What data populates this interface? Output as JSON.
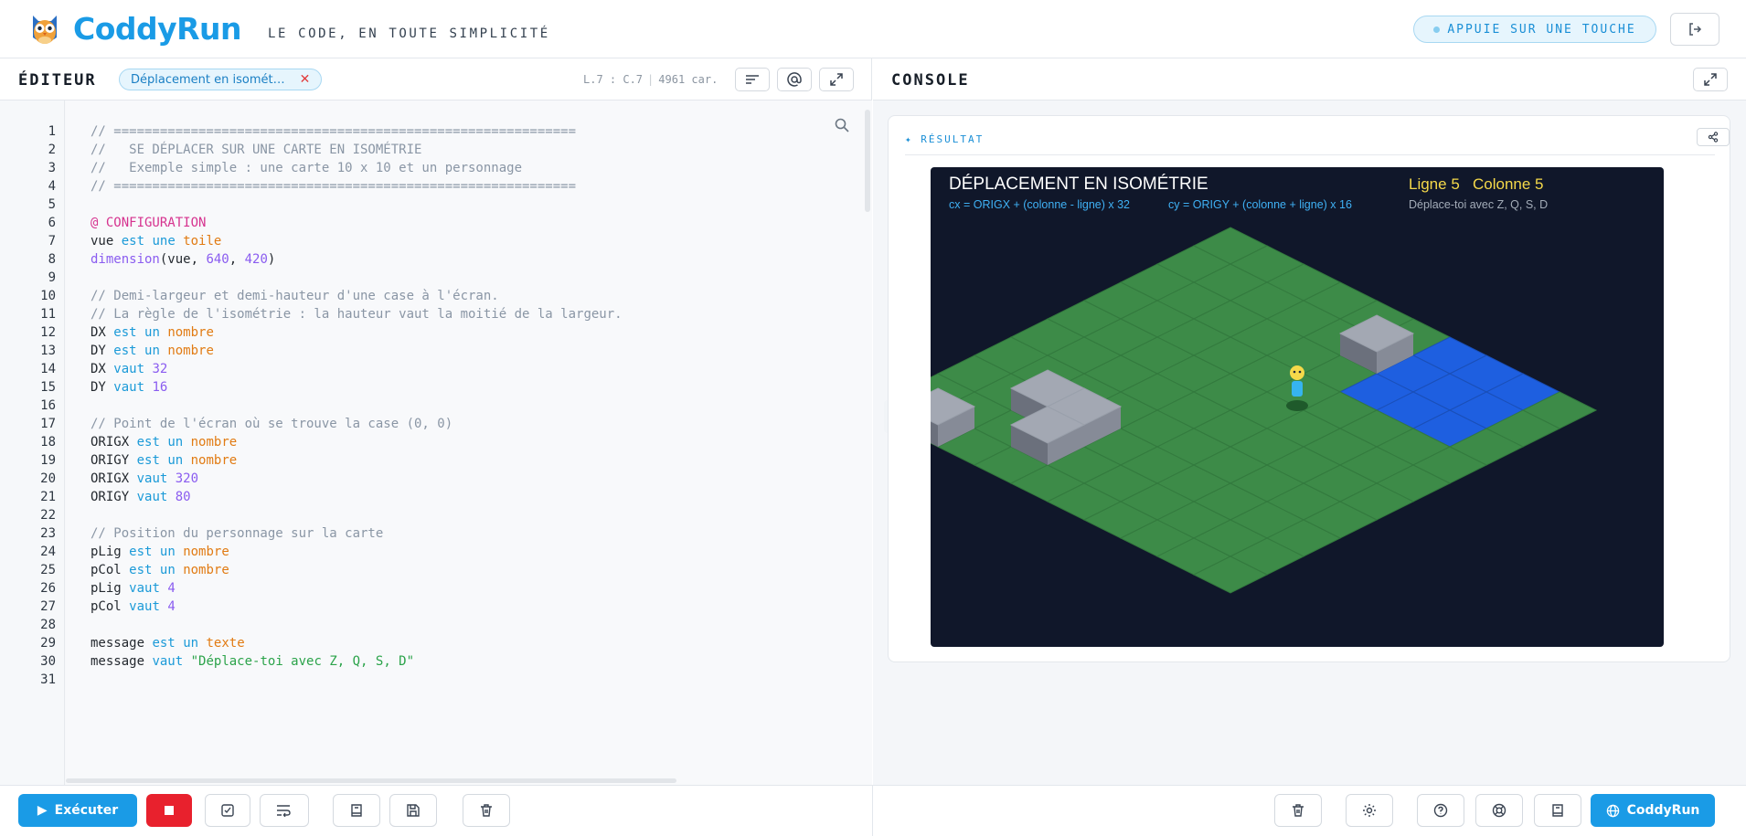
{
  "header": {
    "brand": "CoddyRun",
    "tagline": "LE CODE, EN TOUTE SIMPLICITÉ",
    "key_status": "APPUIE SUR UNE TOUCHE"
  },
  "editor": {
    "title": "ÉDITEUR",
    "file_tag": "Déplacement en isomét…",
    "cursor": "L.7 : C.7",
    "chars": "4961 car.",
    "line_numbers": [
      "1",
      "2",
      "3",
      "4",
      "5",
      "6",
      "7",
      "8",
      "9",
      "10",
      "11",
      "12",
      "13",
      "14",
      "15",
      "16",
      "17",
      "18",
      "19",
      "20",
      "21",
      "22",
      "23",
      "24",
      "25",
      "26",
      "27",
      "28",
      "29",
      "30",
      "31"
    ],
    "code_lines": [
      "// ============================================================",
      "//   SE DÉPLACER SUR UNE CARTE EN ISOMÉTRIE",
      "//   Exemple simple : une carte 10 x 10 et un personnage",
      "// ============================================================",
      "",
      "@ CONFIGURATION",
      "vue est une toile",
      "dimension(vue, 640, 420)",
      "",
      "// Demi-largeur et demi-hauteur d'une case à l'écran.",
      "// La règle de l'isométrie : la hauteur vaut la moitié de la largeur.",
      "DX est un nombre",
      "DY est un nombre",
      "DX vaut 32",
      "DY vaut 16",
      "",
      "// Point de l'écran où se trouve la case (0, 0)",
      "ORIGX est un nombre",
      "ORIGY est un nombre",
      "ORIGX vaut 320",
      "ORIGY vaut 80",
      "",
      "// Position du personnage sur la carte",
      "pLig est un nombre",
      "pCol est un nombre",
      "pLig vaut 4",
      "pCol vaut 4",
      "",
      "message est un texte",
      "message vaut \"Déplace-toi avec Z, Q, S, D\"",
      ""
    ]
  },
  "console": {
    "title": "CONSOLE",
    "result_label": "✦ RÉSULTAT",
    "canvas": {
      "title": "DÉPLACEMENT EN ISOMÉTRIE",
      "formula_x": "cx = ORIGX + (colonne - ligne) x 32",
      "formula_y": "cy = ORIGY + (colonne + ligne) x 16",
      "row_label": "Ligne 5",
      "col_label": "Colonne 5",
      "hint": "Déplace-toi avec Z, Q, S, D"
    }
  },
  "footer": {
    "run_label": "Exécuter",
    "site_label": "CoddyRun"
  },
  "colors": {
    "accent": "#1a9be6",
    "stop": "#e8212d",
    "canvas_bg": "#10172a",
    "grass": "#3d8b48",
    "water": "#1e5fe0",
    "block_top": "#a3a8b3",
    "label_yellow": "#f5d94a",
    "formula_blue": "#3fb1f5"
  },
  "icons": [
    "owl-logo-icon",
    "logout-icon",
    "wrap-icon",
    "at-icon",
    "expand-icon",
    "search-icon",
    "share-icon",
    "chevron-right-icon",
    "play-icon",
    "stop-icon",
    "check-icon",
    "format-icon",
    "book-icon",
    "save-icon",
    "trash-icon",
    "gear-icon",
    "help-icon",
    "support-icon",
    "globe-icon"
  ]
}
